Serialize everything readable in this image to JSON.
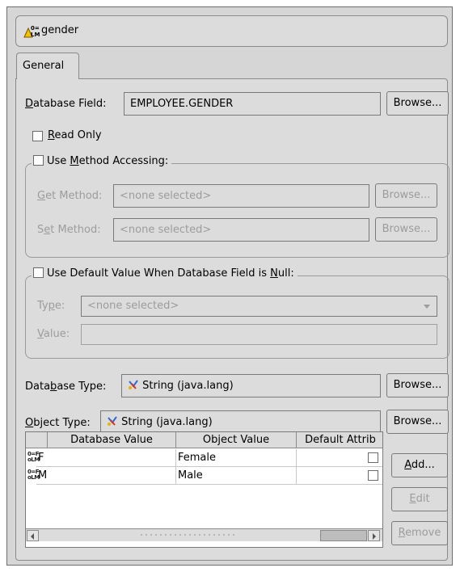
{
  "header": {
    "title": "gender",
    "icon": "mapping-icon"
  },
  "tabs": [
    {
      "label": "General"
    }
  ],
  "database_field": {
    "label": "Database Field:",
    "value": "EMPLOYEE.GENDER",
    "browse": "Browse..."
  },
  "read_only": {
    "label": "Read Only",
    "checked": false
  },
  "method_accessing": {
    "label": "Use Method Accessing:",
    "checked": false,
    "get_label": "Get Method:",
    "get_value": "<none selected>",
    "set_label": "Set Method:",
    "set_value": "<none selected>",
    "browse": "Browse..."
  },
  "default_value": {
    "label": "Use Default Value When Database Field is Null:",
    "checked": false,
    "type_label": "Type:",
    "type_value": "<none selected>",
    "value_label": "Value:",
    "value_value": ""
  },
  "database_type": {
    "label": "Database Type:",
    "value": "String (java.lang)",
    "browse": "Browse..."
  },
  "object_type": {
    "label": "Object Type:",
    "value": "String (java.lang)",
    "browse": "Browse..."
  },
  "table": {
    "columns": [
      "Database Value",
      "Object Value",
      "Default Attrib"
    ],
    "rows": [
      {
        "db": "F",
        "obj": "Female",
        "default": false
      },
      {
        "db": "M",
        "obj": "Male",
        "default": false
      }
    ]
  },
  "buttons": {
    "add": "Add...",
    "edit": "Edit",
    "remove": "Remove"
  },
  "colors": {
    "panel": "#dcdcdc",
    "frame": "#d6d6d6",
    "disabled_text": "#9c9c9c"
  }
}
